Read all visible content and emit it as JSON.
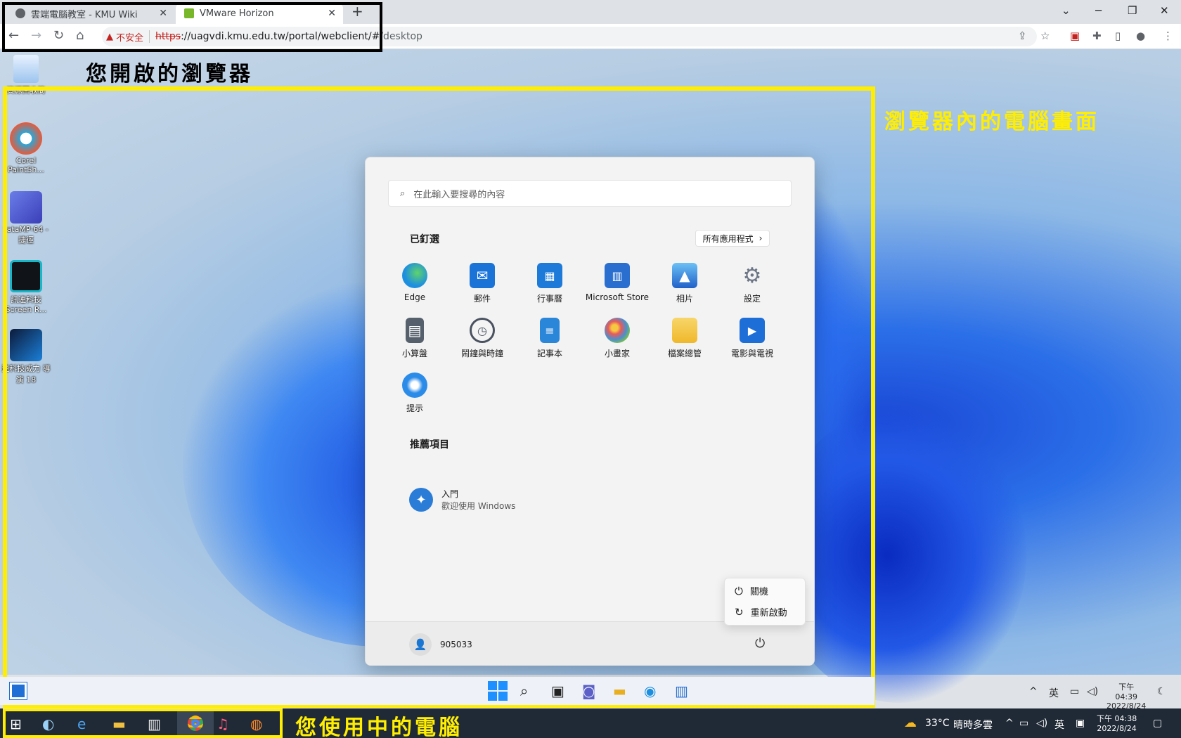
{
  "browser": {
    "tabs": [
      {
        "label": "雲端電腦教室 - KMU Wiki",
        "active": false
      },
      {
        "label": "VMware Horizon",
        "active": true
      }
    ],
    "insecure_label": "不安全",
    "url_scheme": "https",
    "url_main": "://uagvdi.kmu.edu.tw/portal/webclient/#",
    "url_tail": "/desktop"
  },
  "annotations": {
    "browser": "您開啟的瀏覽器",
    "remote": "瀏覽器內的電腦畫面",
    "local": "您使用中的電腦",
    "browser_color": "#000000",
    "highlight_color": "#ffee00"
  },
  "desktop_icons": [
    {
      "label": "資源回收筒",
      "icon": "recycle-bin-icon"
    },
    {
      "label": "Corel PaintSh...",
      "icon": "paintshop-icon"
    },
    {
      "label": "tataMP-64 - 捷徑",
      "icon": "stata-icon"
    },
    {
      "label": "訊連科技 Screen R...",
      "icon": "screen-recorder-icon"
    },
    {
      "label": "連科技威力 導演 18",
      "icon": "powerdirector-icon"
    }
  ],
  "start_menu": {
    "search_placeholder": "在此輸入要搜尋的內容",
    "pinned_title": "已釘選",
    "all_apps_label": "所有應用程式",
    "pinned_apps": [
      {
        "label": "Edge",
        "icon": "edge-icon",
        "color": "#1d8fe0"
      },
      {
        "label": "郵件",
        "icon": "mail-icon",
        "color": "#1a74d8"
      },
      {
        "label": "行事曆",
        "icon": "calendar-icon",
        "color": "#1d7ad8"
      },
      {
        "label": "Microsoft Store",
        "icon": "store-icon",
        "color": "#2a6fd0"
      },
      {
        "label": "相片",
        "icon": "photos-icon",
        "color": "#2d86e0"
      },
      {
        "label": "設定",
        "icon": "settings-icon",
        "color": "#6b7585"
      },
      {
        "label": "小算盤",
        "icon": "calculator-icon",
        "color": "#56606c"
      },
      {
        "label": "鬧鐘與時鐘",
        "icon": "clock-icon",
        "color": "#4a5260"
      },
      {
        "label": "記事本",
        "icon": "notepad-icon",
        "color": "#2a86d8"
      },
      {
        "label": "小畫家",
        "icon": "paint-icon",
        "color": "#4b8fd0"
      },
      {
        "label": "檔案總管",
        "icon": "folder-icon",
        "color": "#f0c040"
      },
      {
        "label": "電影與電視",
        "icon": "movies-icon",
        "color": "#1e6ed8"
      },
      {
        "label": "提示",
        "icon": "tips-icon",
        "color": "#2b8be8"
      }
    ],
    "recommended_title": "推薦項目",
    "recommended": [
      {
        "title": "入門",
        "subtitle": "歡迎使用 Windows",
        "icon": "get-started-icon"
      }
    ],
    "user_name": "905033",
    "power_menu": [
      {
        "label": "關機",
        "icon": "power-icon"
      },
      {
        "label": "重新啟動",
        "icon": "restart-icon"
      }
    ]
  },
  "inner_taskbar": {
    "tray_lang": "英",
    "clock_time": "下午 04:39",
    "clock_date": "2022/8/24"
  },
  "host_taskbar": {
    "weather_temp": "33°C",
    "weather_desc": "晴時多雲",
    "tray_lang": "英",
    "clock_time": "下午 04:38",
    "clock_date": "2022/8/24"
  }
}
